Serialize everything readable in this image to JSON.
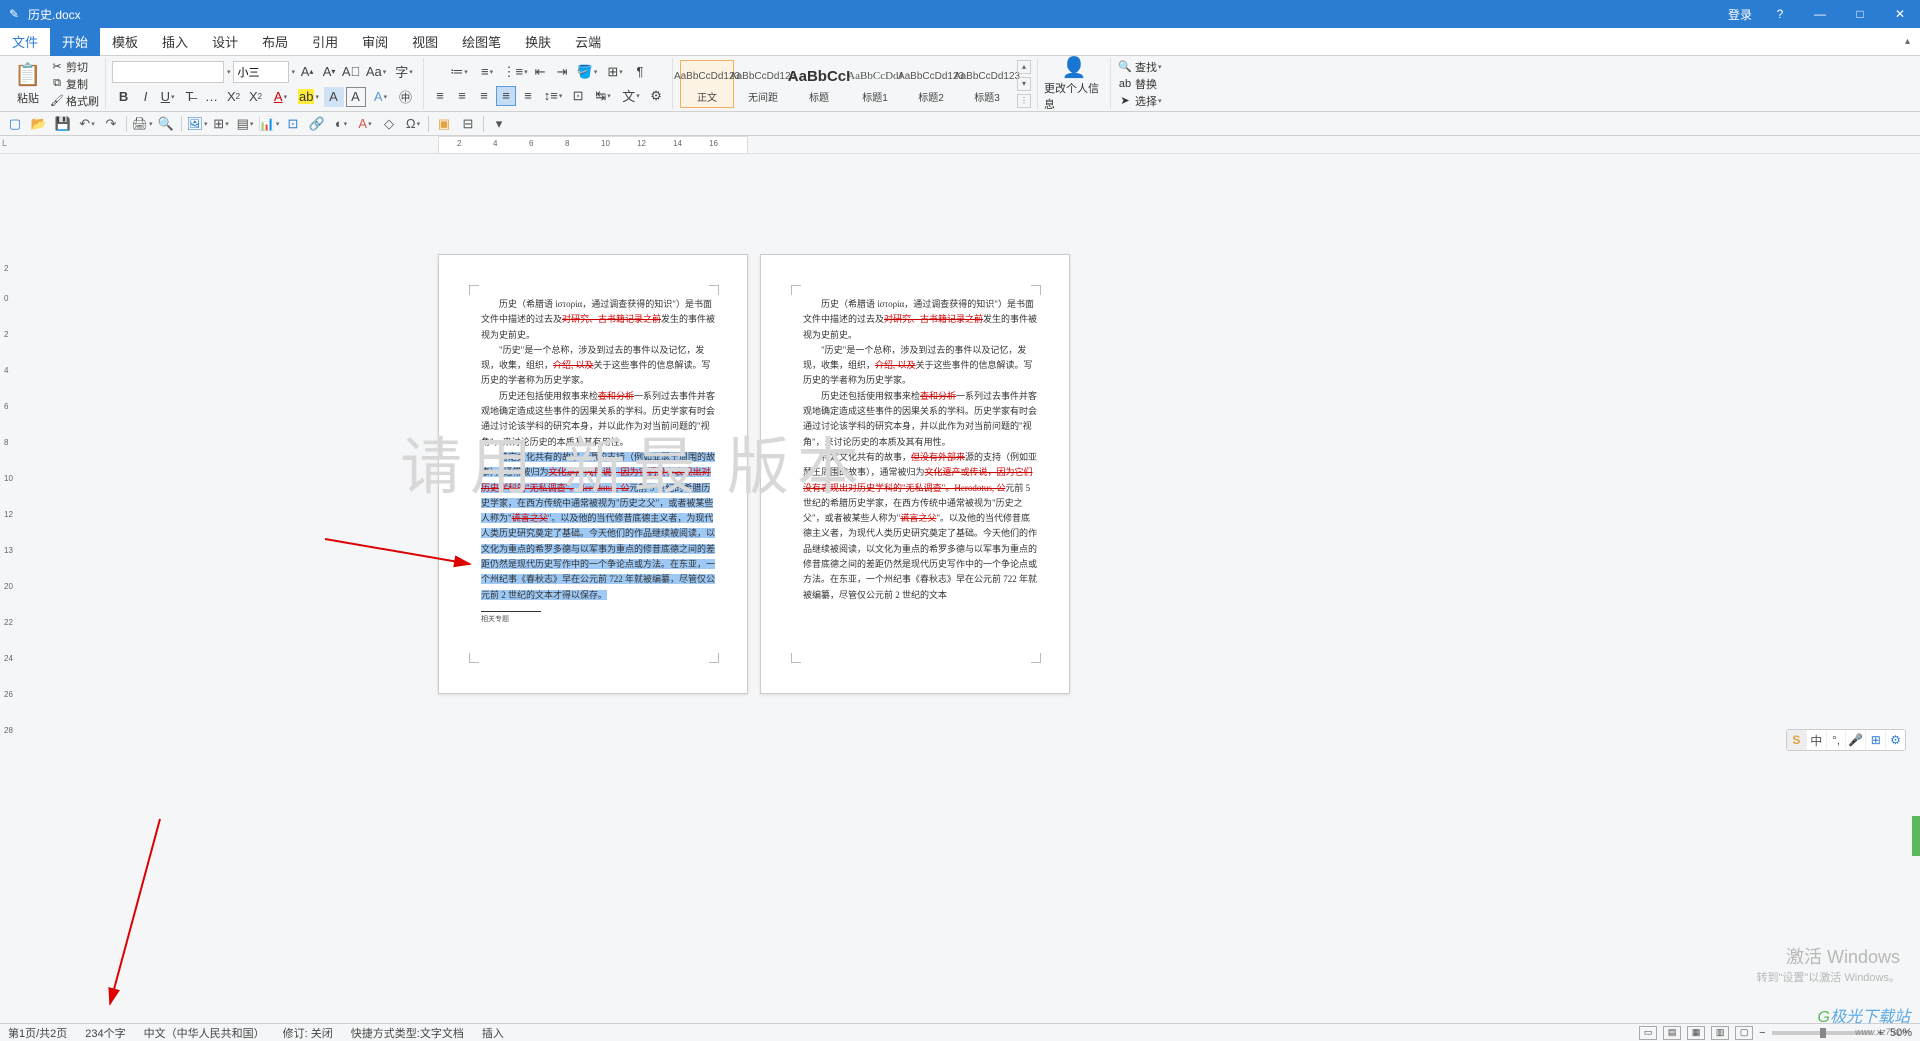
{
  "titlebar": {
    "doc_title": "历史.docx",
    "login": "登录",
    "help": "?",
    "min": "—",
    "max": "□",
    "close": "✕"
  },
  "menu": {
    "file": "文件",
    "home": "开始",
    "template": "模板",
    "insert": "插入",
    "design": "设计",
    "layout": "布局",
    "reference": "引用",
    "review": "审阅",
    "view": "视图",
    "draw": "绘图笔",
    "skin": "换肤",
    "cloud": "云端"
  },
  "ribbon": {
    "paste": "粘贴",
    "cut": "剪切",
    "copy": "复制",
    "format_painter": "格式刷",
    "font_name": "",
    "font_size": "小三",
    "change_info": "更改个人信息",
    "find": "查找",
    "replace": "替换",
    "select": "选择"
  },
  "styles": {
    "s1": {
      "preview": "AaBbCcDd123",
      "name": "正文"
    },
    "s2": {
      "preview": "AaBbCcDd123",
      "name": "无间距"
    },
    "s3": {
      "preview": "AaBbCcI",
      "name": "标题"
    },
    "s4": {
      "preview": "AaBbCcDdJ",
      "name": "标题1"
    },
    "s5": {
      "preview": "AaBbCcDd123",
      "name": "标题2"
    },
    "s6": {
      "preview": "AaBbCcDd123",
      "name": "标题3"
    }
  },
  "ruler": {
    "marks": [
      "2",
      "4",
      "6",
      "8",
      "10",
      "12",
      "14",
      "16"
    ]
  },
  "vruler": {
    "marks": [
      "2",
      "0",
      "2",
      "4",
      "6",
      "8",
      "10",
      "12",
      "13",
      "20",
      "22",
      "24",
      "26",
      "28"
    ]
  },
  "doc": {
    "p1": "历史（希腊语 ἱστορία，通过调查获得的知识\"）是书面文件中描述的过去及",
    "p1_strike": "对研究、古书籍记录之前",
    "p1_end": "发生的事件被视为史前史。",
    "p2": "\"历史\"是一个总称，涉及到过去的事件以及记忆，发现，收集，组织，",
    "p2_strike": "介绍, 以及",
    "p2_end": "关于这些事件的信息解读。写历史的学者称为历史学家。",
    "p3a": "历史还包括使用叙事来检",
    "p3_strike": "查和分析",
    "p3b": "一系列过去事件并客观地确定造成这些事件的因果关系的学科。历史学家有时会通过讨论该学科的研究本身，并以此作为对当前问题的\"视角\"，来讨论历史的本质及其有用性。",
    "p4a": "特定文化共有的故事，",
    "p4_strike1": "但没有外部来",
    "p4b": "源的支持（例如亚瑟王周围的故事），通常被归为",
    "p4_strike2": "文化遗产或传说，因为它们没有表现出对历史学科的\"无私调查\"。Herodotus, 公",
    "p4c": "元前 5 世纪的希腊历史学家，在西方传统中通常被视为\"历史之父\"，或者被某些人称为\"",
    "p4_strike3": "谎言之父",
    "p4d": "\"。以及他的当代修昔底德主义者，为现代人类历史研究奠定了基础。今天他们的作品继续被阅读，以文化为重点的希罗多德与以军事为重点的修昔底德之间的差距仍然是现代历史写作中的一个争论点或方法。在东亚，一个州纪事《春秋志》早在公元前 722 年就被编纂，尽管仅公元前 2 世纪的文本才得以保存。",
    "footnote": "相关专题",
    "p2_1": "历史（希腊语 ἱστορία，通过调查获得的知识\"）是书面文件中描述的过去及",
    "p2_1_strike": "对研究、古书籍记录之前",
    "p2_1_end": "发生的事件被视为史前史。",
    "p2_2": "\"历史\"是一个总称，涉及到过去的事件以及记忆，发现，收集，组织，",
    "p2_2_strike": "介绍, 以及",
    "p2_2_end": "关于这些事件的信息解读。写历史的学者称为历史学家。",
    "p2_3a": "历史还包括使用叙事来检",
    "p2_3_strike": "查和分析",
    "p2_3b": "一系列过去事件并客观地确定造成这些事件的因果关系的学科。历史学家有时会通过讨论该学科的研究本身，并以此作为对当前问题的\"视角\"，来讨论历史的本质及其有用性。",
    "p2_4a": "特定文化共有的故事，",
    "p2_4_strike1": "但没有外部来",
    "p2_4b": "源的支持（例如亚瑟王周围的故事），通常被归为",
    "p2_4_strike2": "文化遗产或传说，因为它们没有表现出对历史学科的\"无私调查\"。Herodotus, 公",
    "p2_4c": "元前 5 世纪的希腊历史学家，在西方传统中通常被视为\"历史之父\"，或者被某些人称为\"",
    "p2_4_strike3": "谎言之父",
    "p2_4d": "\"。以及他的当代修昔底德主义者，为现代人类历史研究奠定了基础。今天他们的作品继续被阅读，以文化为重点的希罗多德与以军事为重点的修昔底德之间的差距仍然是现代历史写作中的一个争论点或方法。在东亚，一个州纪事《春秋志》早在公元前 722 年就被编纂，尽管仅公元前 2 世纪的文本"
  },
  "watermark": "请用  新最   版本",
  "activation": {
    "title": "激活 Windows",
    "sub": "转到\"设置\"以激活 Windows。"
  },
  "ime": {
    "logo": "S",
    "lang": "中",
    "punct": "°,",
    "mic": "🎤",
    "grid": "⊞",
    "set": "⚙"
  },
  "status": {
    "page": "第1页/共2页",
    "words": "234个字",
    "lang": "中文（中华人民共和国）",
    "track": "修订: 关闭",
    "shortcut": "快捷方式类型:文字文档",
    "mode": "插入",
    "zoom": "50%"
  },
  "site": {
    "name": "极光下载站",
    "url": "www.xz7.com"
  }
}
